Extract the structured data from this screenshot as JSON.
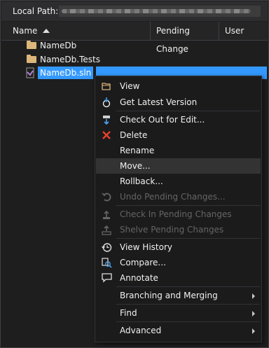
{
  "local_path": {
    "label": "Local Path:"
  },
  "columns": {
    "name": "Name",
    "pending_change": "Pending Change",
    "user": "User"
  },
  "tree": [
    {
      "label": "NameDb",
      "icon": "folder-icon"
    },
    {
      "label": "NameDb.Tests",
      "icon": "folder-icon"
    },
    {
      "label": "NameDb.sln",
      "icon": "solution-file-icon",
      "selected": true
    }
  ],
  "context_menu": {
    "items": [
      {
        "label": "View",
        "icon": "folder-open-icon",
        "enabled": true
      },
      {
        "label": "Get Latest Version",
        "icon": "get-latest-icon",
        "enabled": true
      },
      {
        "label": "Check Out for Edit...",
        "icon": "check-out-icon",
        "enabled": true
      },
      {
        "label": "Delete",
        "icon": "delete-x-icon",
        "enabled": true,
        "accent": "#e8412b"
      },
      {
        "label": "Rename",
        "enabled": true
      },
      {
        "label": "Move...",
        "enabled": true,
        "hovered": true
      },
      {
        "label": "Rollback...",
        "enabled": true
      },
      {
        "label": "Undo Pending Changes...",
        "icon": "undo-icon",
        "enabled": false
      },
      {
        "label": "Check In Pending Changes",
        "icon": "check-in-icon",
        "enabled": false
      },
      {
        "label": "Shelve Pending Changes",
        "icon": "shelve-icon",
        "enabled": false
      },
      {
        "label": "View History",
        "icon": "history-icon",
        "enabled": true
      },
      {
        "label": "Compare...",
        "icon": "compare-icon",
        "enabled": true
      },
      {
        "label": "Annotate",
        "icon": "annotate-icon",
        "enabled": true
      },
      {
        "label": "Branching and Merging",
        "enabled": true,
        "submenu": true
      },
      {
        "label": "Find",
        "enabled": true,
        "submenu": true
      },
      {
        "label": "Advanced",
        "enabled": true,
        "submenu": true
      }
    ]
  },
  "colors": {
    "background": "#1e1e1e",
    "selection": "#3399ff",
    "folder": "#dcb67a",
    "menu_bg": "#1b1b1c",
    "disabled_text": "#656565"
  }
}
